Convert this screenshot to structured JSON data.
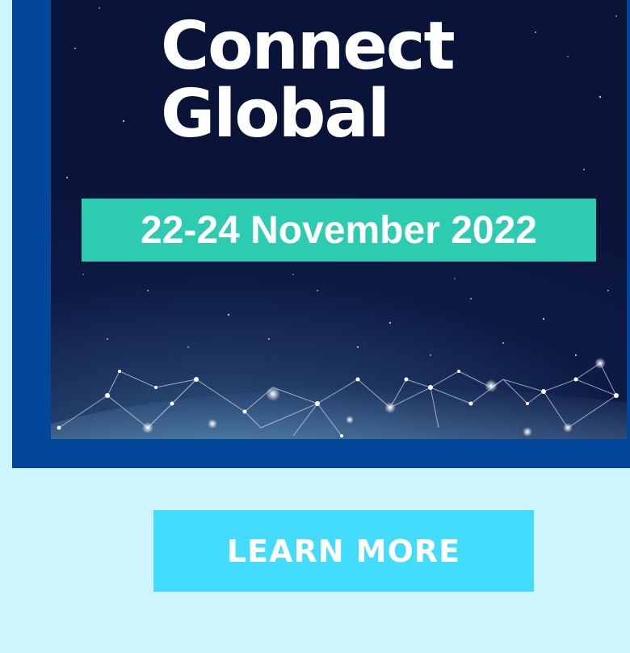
{
  "banner": {
    "title_line_1": "Connect",
    "title_line_2": "Global",
    "date_text": "22-24 November 2022",
    "date_bar_color": "#2dccb0",
    "background_color": "#0a1338"
  },
  "cta": {
    "label": "LEARN MORE",
    "color": "#44dcfd"
  },
  "frame_color": "#03479a",
  "page_background": "#ccf5fe"
}
